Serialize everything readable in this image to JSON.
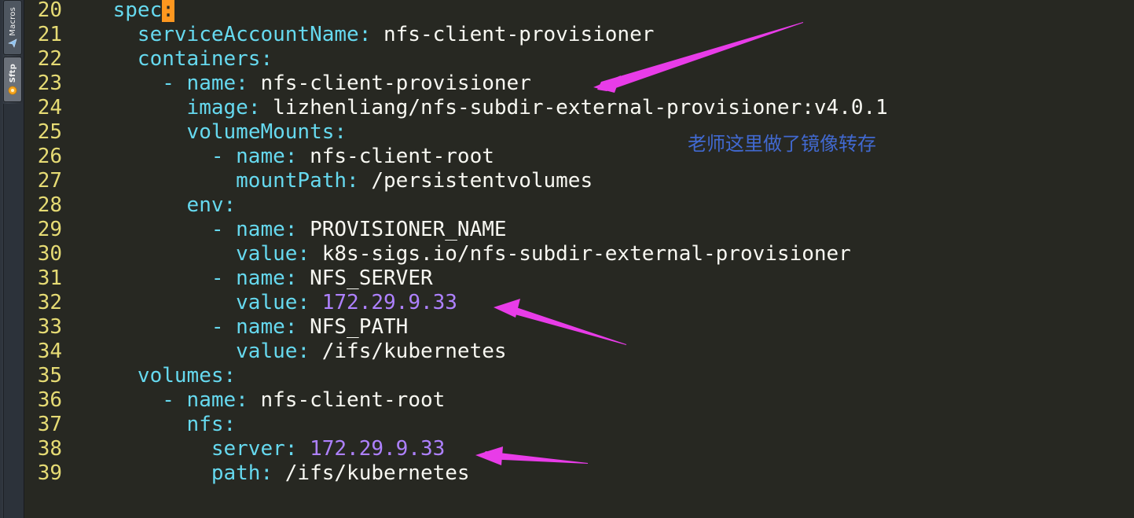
{
  "dock": {
    "macros_label": "Macros",
    "sftp_label": "Sftp"
  },
  "lines": [
    {
      "num": "20",
      "indent": "    ",
      "key": "spec",
      "colon": ":",
      "value": "",
      "cursor": true
    },
    {
      "num": "21",
      "indent": "      ",
      "key": "serviceAccountName",
      "colon": ":",
      "value": " nfs-client-provisioner"
    },
    {
      "num": "22",
      "indent": "      ",
      "key": "containers",
      "colon": ":",
      "value": ""
    },
    {
      "num": "23",
      "indent": "        ",
      "dash": "- ",
      "key": "name",
      "colon": ":",
      "value": " nfs-client-provisioner"
    },
    {
      "num": "24",
      "indent": "          ",
      "key": "image",
      "colon": ":",
      "value": " lizhenliang/nfs-subdir-external-provisioner:v4.0.1"
    },
    {
      "num": "25",
      "indent": "          ",
      "key": "volumeMounts",
      "colon": ":",
      "value": ""
    },
    {
      "num": "26",
      "indent": "            ",
      "dash": "- ",
      "key": "name",
      "colon": ":",
      "value": " nfs-client-root"
    },
    {
      "num": "27",
      "indent": "              ",
      "key": "mountPath",
      "colon": ":",
      "value": " /persistentvolumes"
    },
    {
      "num": "28",
      "indent": "          ",
      "key": "env",
      "colon": ":",
      "value": ""
    },
    {
      "num": "29",
      "indent": "            ",
      "dash": "- ",
      "key": "name",
      "colon": ":",
      "value": " PROVISIONER_NAME"
    },
    {
      "num": "30",
      "indent": "              ",
      "key": "value",
      "colon": ":",
      "value": " k8s-sigs.io/nfs-subdir-external-provisioner"
    },
    {
      "num": "31",
      "indent": "            ",
      "dash": "- ",
      "key": "name",
      "colon": ":",
      "value": " NFS_SERVER"
    },
    {
      "num": "32",
      "indent": "              ",
      "key": "value",
      "colon": ":",
      "value": " 172.29.9.33",
      "numeric": true
    },
    {
      "num": "33",
      "indent": "            ",
      "dash": "- ",
      "key": "name",
      "colon": ":",
      "value": " NFS_PATH"
    },
    {
      "num": "34",
      "indent": "              ",
      "key": "value",
      "colon": ":",
      "value": " /ifs/kubernetes"
    },
    {
      "num": "35",
      "indent": "      ",
      "key": "volumes",
      "colon": ":",
      "value": ""
    },
    {
      "num": "36",
      "indent": "        ",
      "dash": "- ",
      "key": "name",
      "colon": ":",
      "value": " nfs-client-root"
    },
    {
      "num": "37",
      "indent": "          ",
      "key": "nfs",
      "colon": ":",
      "value": ""
    },
    {
      "num": "38",
      "indent": "            ",
      "key": "server",
      "colon": ":",
      "value": " 172.29.9.33",
      "numeric": true
    },
    {
      "num": "39",
      "indent": "            ",
      "key": "path",
      "colon": ":",
      "value": " /ifs/kubernetes"
    }
  ],
  "annotation": "老师这里做了镜像转存",
  "colors": {
    "background": "#272822",
    "line_number": "#e6db74",
    "key": "#66d9ef",
    "text": "#f8f8f2",
    "number": "#ae81ff",
    "cursor": "#fd971f",
    "annotation": "#4169d0",
    "arrow": "#e83ce8"
  }
}
